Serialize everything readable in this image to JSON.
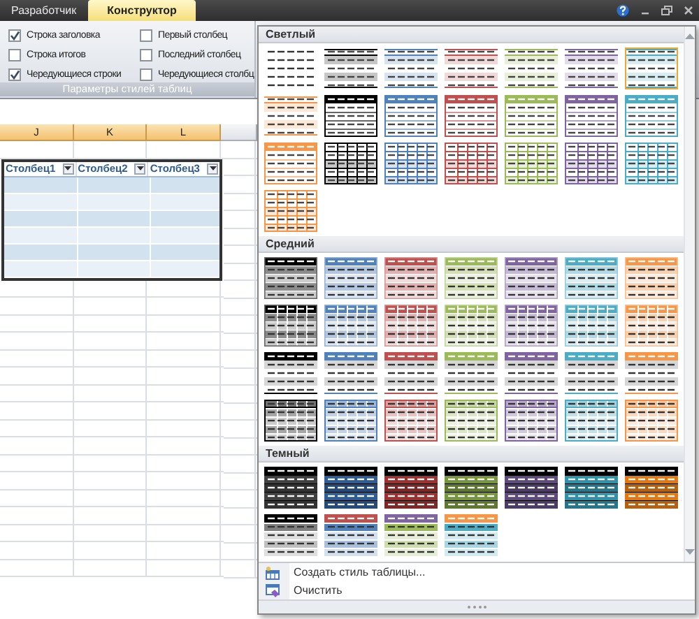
{
  "tabs": [
    {
      "label": "Разработчик",
      "selected": false
    },
    {
      "label": "Конструктор",
      "selected": true
    }
  ],
  "style_options": {
    "title": "Параметры стилей таблиц",
    "options": [
      {
        "label": "Строка заголовка",
        "checked": true
      },
      {
        "label": "Строка итогов",
        "checked": false
      },
      {
        "label": "Чередующиеся строки",
        "checked": true
      },
      {
        "label": "Первый столбец",
        "checked": false
      },
      {
        "label": "Последний столбец",
        "checked": false
      },
      {
        "label": "Чередующиеся столбц",
        "checked": false
      }
    ]
  },
  "sheet": {
    "columns": [
      {
        "label": "J",
        "selected": true
      },
      {
        "label": "K",
        "selected": true
      },
      {
        "label": "L",
        "selected": true
      }
    ],
    "table": {
      "headers": [
        "Столбец1",
        "Столбец2",
        "Столбец3"
      ]
    }
  },
  "gallery": {
    "sections": [
      {
        "title": "Светлый",
        "styles": [
          {
            "kind": "plain",
            "selected": false
          },
          {
            "kind": "light-banded",
            "color": "#000000",
            "selected": false
          },
          {
            "kind": "light-banded",
            "color": "#4f81bd",
            "selected": false
          },
          {
            "kind": "light-banded",
            "color": "#c0504d",
            "selected": false
          },
          {
            "kind": "light-banded",
            "color": "#9bbb59",
            "selected": false
          },
          {
            "kind": "light-banded",
            "color": "#8064a2",
            "selected": false
          },
          {
            "kind": "light-banded",
            "color": "#4bacc6",
            "selected": true
          },
          {
            "kind": "light-banded",
            "color": "#f79646",
            "selected": false
          },
          {
            "kind": "light-header",
            "color": "#000000",
            "selected": false
          },
          {
            "kind": "light-header",
            "color": "#4f81bd",
            "selected": false
          },
          {
            "kind": "light-header",
            "color": "#c0504d",
            "selected": false
          },
          {
            "kind": "light-header",
            "color": "#9bbb59",
            "selected": false
          },
          {
            "kind": "light-header",
            "color": "#8064a2",
            "selected": false
          },
          {
            "kind": "light-header",
            "color": "#4bacc6",
            "selected": false
          },
          {
            "kind": "light-header",
            "color": "#f79646",
            "selected": false
          },
          {
            "kind": "light-grid",
            "color": "#000000",
            "selected": false
          },
          {
            "kind": "light-grid",
            "color": "#4f81bd",
            "selected": false
          },
          {
            "kind": "light-grid",
            "color": "#c0504d",
            "selected": false
          },
          {
            "kind": "light-grid",
            "color": "#9bbb59",
            "selected": false
          },
          {
            "kind": "light-grid",
            "color": "#8064a2",
            "selected": false
          },
          {
            "kind": "light-grid",
            "color": "#4bacc6",
            "selected": false
          },
          {
            "kind": "light-grid",
            "color": "#f79646",
            "selected": false
          }
        ]
      },
      {
        "title": "Средний",
        "styles": [
          {
            "kind": "medium-header",
            "color": "#000000",
            "selected": false
          },
          {
            "kind": "medium-header",
            "color": "#4f81bd",
            "selected": false
          },
          {
            "kind": "medium-header",
            "color": "#c0504d",
            "selected": false
          },
          {
            "kind": "medium-header",
            "color": "#9bbb59",
            "selected": false
          },
          {
            "kind": "medium-header",
            "color": "#8064a2",
            "selected": false
          },
          {
            "kind": "medium-header",
            "color": "#4bacc6",
            "selected": false
          },
          {
            "kind": "medium-header",
            "color": "#f79646",
            "selected": false
          },
          {
            "kind": "medium-grid",
            "color": "#000000",
            "selected": false
          },
          {
            "kind": "medium-grid",
            "color": "#4f81bd",
            "selected": false
          },
          {
            "kind": "medium-grid",
            "color": "#c0504d",
            "selected": false
          },
          {
            "kind": "medium-grid",
            "color": "#9bbb59",
            "selected": false
          },
          {
            "kind": "medium-grid",
            "color": "#8064a2",
            "selected": false
          },
          {
            "kind": "medium-grid",
            "color": "#4bacc6",
            "selected": false
          },
          {
            "kind": "medium-grid",
            "color": "#f79646",
            "selected": false
          },
          {
            "kind": "medium-dark-header",
            "color": "#000000",
            "selected": false
          },
          {
            "kind": "medium-dark-header",
            "color": "#4f81bd",
            "selected": false
          },
          {
            "kind": "medium-dark-header",
            "color": "#c0504d",
            "selected": false
          },
          {
            "kind": "medium-dark-header",
            "color": "#9bbb59",
            "selected": false
          },
          {
            "kind": "medium-dark-header",
            "color": "#8064a2",
            "selected": false
          },
          {
            "kind": "medium-dark-header",
            "color": "#4bacc6",
            "selected": false
          },
          {
            "kind": "medium-dark-header",
            "color": "#f79646",
            "selected": false
          },
          {
            "kind": "medium-pale",
            "color": "#000000",
            "selected": false
          },
          {
            "kind": "medium-pale",
            "color": "#4f81bd",
            "selected": false
          },
          {
            "kind": "medium-pale",
            "color": "#c0504d",
            "selected": false
          },
          {
            "kind": "medium-pale",
            "color": "#9bbb59",
            "selected": false
          },
          {
            "kind": "medium-pale",
            "color": "#8064a2",
            "selected": false
          },
          {
            "kind": "medium-pale",
            "color": "#4bacc6",
            "selected": false
          },
          {
            "kind": "medium-pale",
            "color": "#f79646",
            "selected": false
          }
        ]
      },
      {
        "title": "Темный",
        "styles": [
          {
            "kind": "dark",
            "color": "#404040",
            "selected": false
          },
          {
            "kind": "dark",
            "color": "#2c5d98",
            "selected": false
          },
          {
            "kind": "dark",
            "color": "#a0302d",
            "selected": false
          },
          {
            "kind": "dark",
            "color": "#76963a",
            "selected": false
          },
          {
            "kind": "dark",
            "color": "#5f4a80",
            "selected": false
          },
          {
            "kind": "dark",
            "color": "#2d93ad",
            "selected": false
          },
          {
            "kind": "dark",
            "color": "#e6770f",
            "selected": false
          },
          {
            "kind": "dark-duo",
            "color": "#000000",
            "body": {
              "color": "#7f7f7f"
            },
            "selected": false
          },
          {
            "kind": "dark-duo",
            "color": "#c0504d",
            "body": {
              "color": "#4f81bd"
            },
            "selected": false
          },
          {
            "kind": "dark-duo",
            "color": "#8064a2",
            "body": {
              "color": "#9bbb59"
            },
            "selected": false
          },
          {
            "kind": "dark-duo",
            "color": "#f79646",
            "body": {
              "color": "#4bacc6"
            },
            "selected": false
          }
        ]
      }
    ],
    "commands": [
      {
        "kind": "new",
        "label": "Создать стиль таблицы..."
      },
      {
        "kind": "clear",
        "label": "Очистить"
      }
    ]
  }
}
